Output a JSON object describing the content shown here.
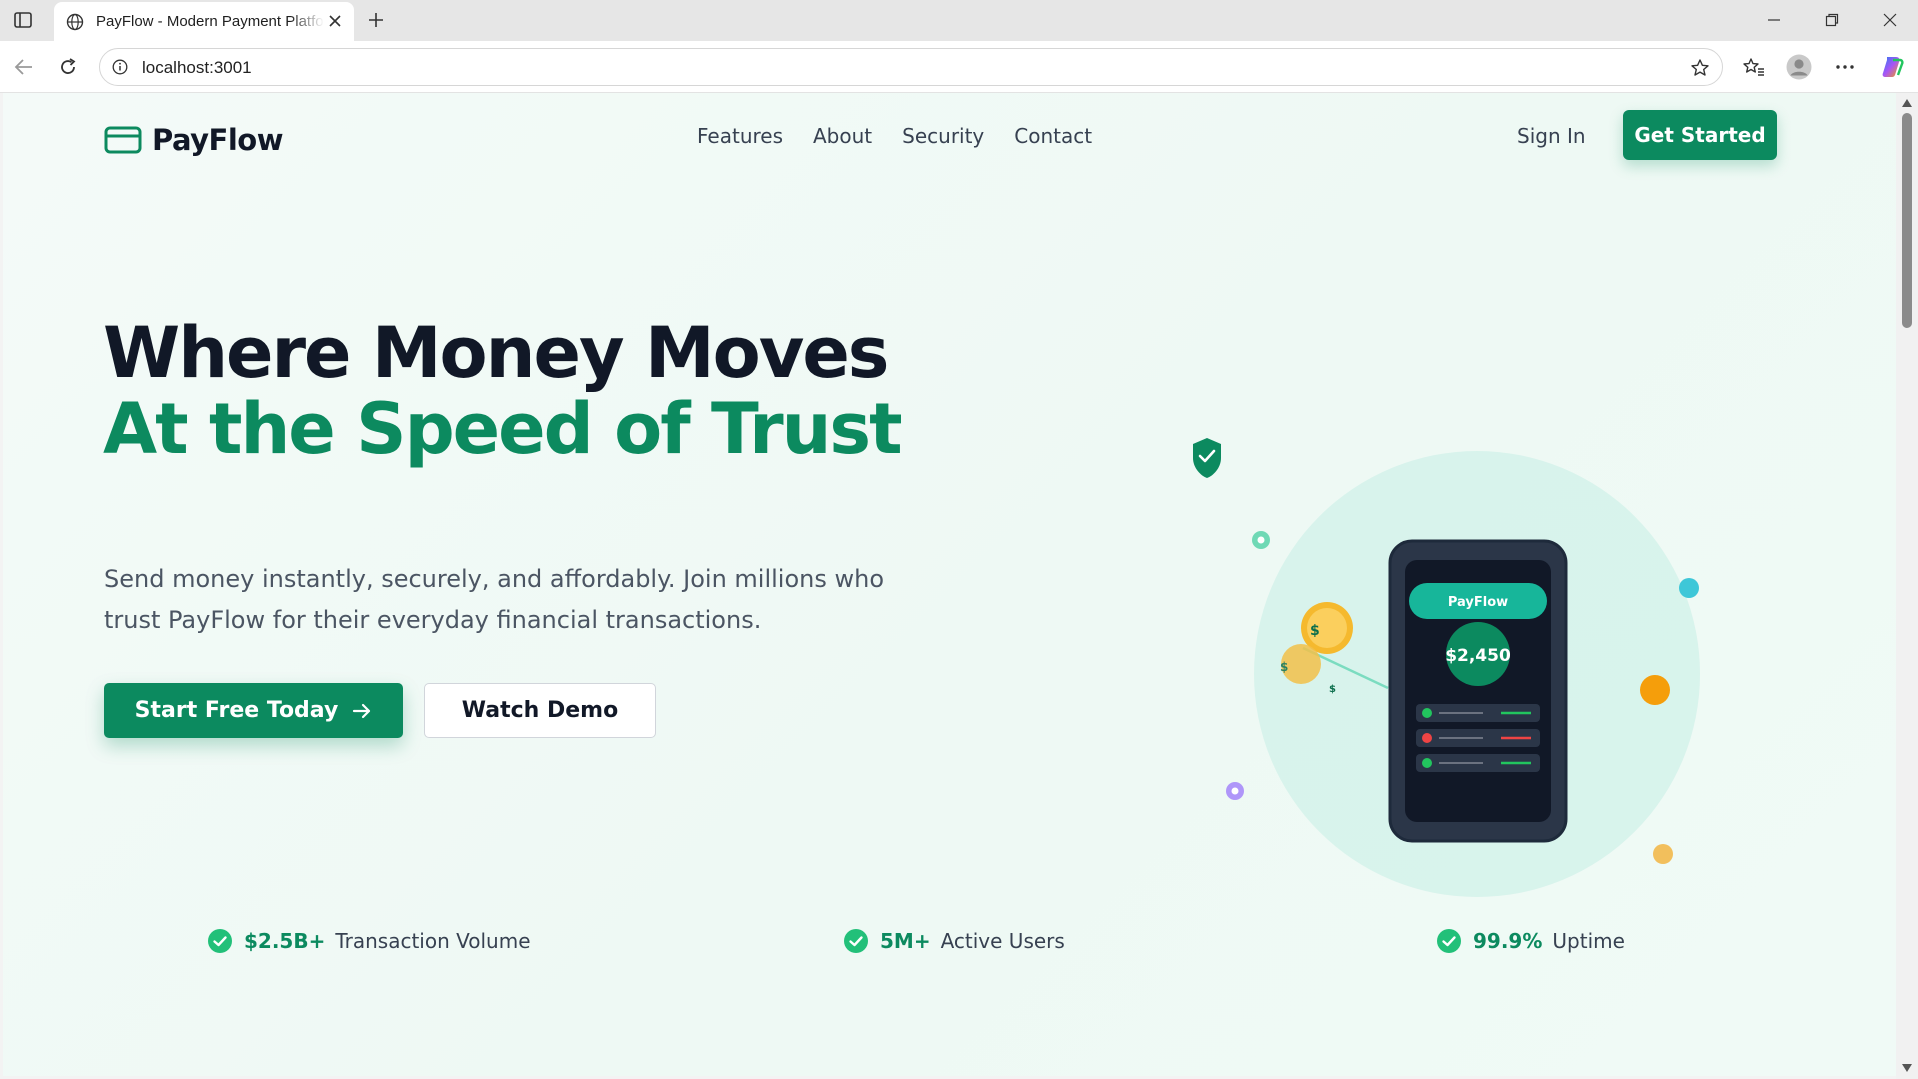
{
  "browser": {
    "tab_title": "PayFlow - Modern Payment Platform",
    "url": "localhost:3001",
    "icons": [
      "sidebar-toggle-icon",
      "globe-icon",
      "close-icon",
      "plus-icon",
      "minimize-icon",
      "restore-icon",
      "window-close-icon",
      "back-icon",
      "reload-icon",
      "info-icon",
      "star-icon",
      "favorites-icon",
      "profile-icon",
      "more-icon",
      "copilot-icon"
    ]
  },
  "nav": {
    "brand": "PayFlow",
    "links": [
      "Features",
      "About",
      "Security",
      "Contact"
    ],
    "sign_in": "Sign In",
    "get_started": "Get Started"
  },
  "hero": {
    "title_line1": "Where Money Moves",
    "title_line2": "At the Speed of Trust",
    "subtitle": "Send money instantly, securely, and affordably. Join millions who trust PayFlow for their everyday financial transactions.",
    "cta_primary": "Start Free Today",
    "cta_secondary": "Watch Demo"
  },
  "phone": {
    "brand": "PayFlow",
    "balance": "$2,450",
    "coin_symbol": "$"
  },
  "stats": [
    {
      "value": "$2.5B+",
      "label": "Transaction Volume"
    },
    {
      "value": "5M+",
      "label": "Active Users"
    },
    {
      "value": "99.9%",
      "label": "Uptime"
    }
  ],
  "colors": {
    "brand_green": "#0c8a5f",
    "heading_dark": "#111827",
    "body_text": "#4b5563",
    "coin_gold": "#f5b92e",
    "accent_teal": "#22c0a8",
    "transaction_red": "#ef4444"
  }
}
